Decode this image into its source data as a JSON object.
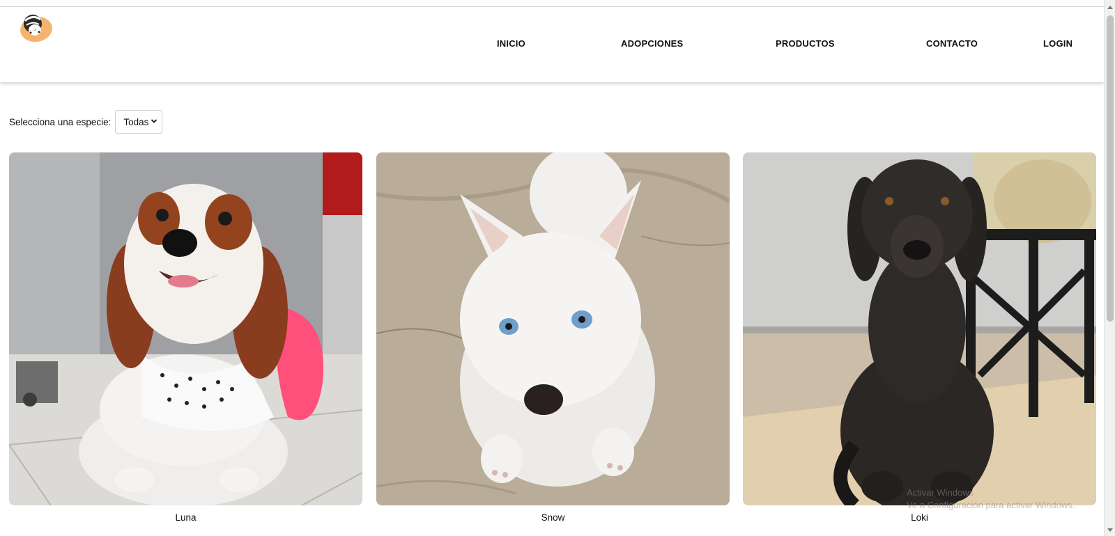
{
  "nav": {
    "logo_icon": "paw-cat-logo-icon",
    "items": [
      {
        "label": "INICIO"
      },
      {
        "label": "ADOPCIONES"
      },
      {
        "label": "PRODUCTOS"
      },
      {
        "label": "CONTACTO"
      },
      {
        "label": "LOGIN"
      }
    ]
  },
  "filter": {
    "label": "Selecciona una especie:",
    "selected": "Todas"
  },
  "pets": [
    {
      "name": "Luna",
      "photo": "spaniel-puppy-pink-dress"
    },
    {
      "name": "Snow",
      "photo": "white-husky-puppy"
    },
    {
      "name": "Loki",
      "photo": "black-labrador"
    }
  ],
  "watermark": {
    "line1": "Activar Windows",
    "line2": "Ve a Configuración para activar Windows."
  },
  "colors": {
    "logo_orange": "#f5b36b",
    "header_bg": "#ffffff",
    "text": "#111111"
  }
}
